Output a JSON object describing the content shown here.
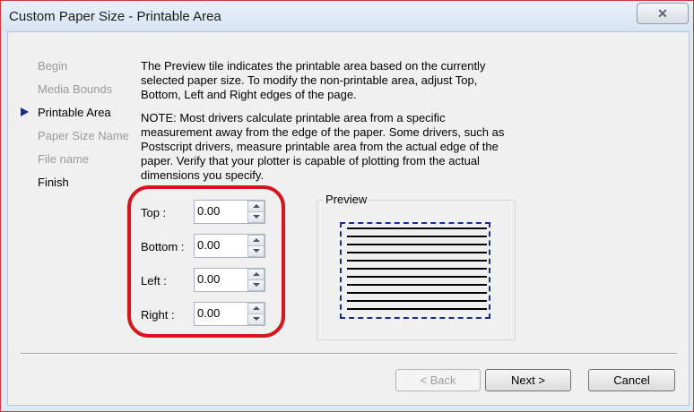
{
  "window": {
    "title": "Custom Paper Size - Printable Area",
    "close_symbol": "✕"
  },
  "nav": {
    "items": [
      {
        "label": "Begin",
        "state": "disabled"
      },
      {
        "label": "Media Bounds",
        "state": "disabled"
      },
      {
        "label": "Printable Area",
        "state": "current"
      },
      {
        "label": "Paper Size Name",
        "state": "disabled"
      },
      {
        "label": "File name",
        "state": "disabled"
      },
      {
        "label": "Finish",
        "state": "enabled"
      }
    ],
    "current_icon": "right-arrow-icon"
  },
  "content": {
    "intro_lines": [
      "The Preview tile indicates the printable area based on the currently",
      "selected paper size. To modify the non-printable area, adjust Top,",
      "Bottom, Left and Right edges of the page."
    ],
    "note_lines": [
      "NOTE: Most drivers calculate printable area from a specific",
      "measurement away from the edge of the paper. Some drivers, such as",
      "Postscript drivers, measure printable area from the actual edge of the",
      "paper. Verify that your plotter is capable of plotting from the actual",
      "dimensions you specify."
    ]
  },
  "margins": {
    "top": {
      "label": "Top :",
      "value": "0.00"
    },
    "bottom": {
      "label": "Bottom :",
      "value": "0.00"
    },
    "left": {
      "label": "Left :",
      "value": "0.00"
    },
    "right": {
      "label": "Right :",
      "value": "0.00"
    }
  },
  "preview": {
    "label": "Preview"
  },
  "buttons": {
    "back": "< Back",
    "next": "Next >",
    "cancel": "Cancel"
  },
  "colors": {
    "highlight": "#d6161e",
    "current_arrow": "#1b2a8c",
    "preview_border": "#1b2a8c"
  }
}
